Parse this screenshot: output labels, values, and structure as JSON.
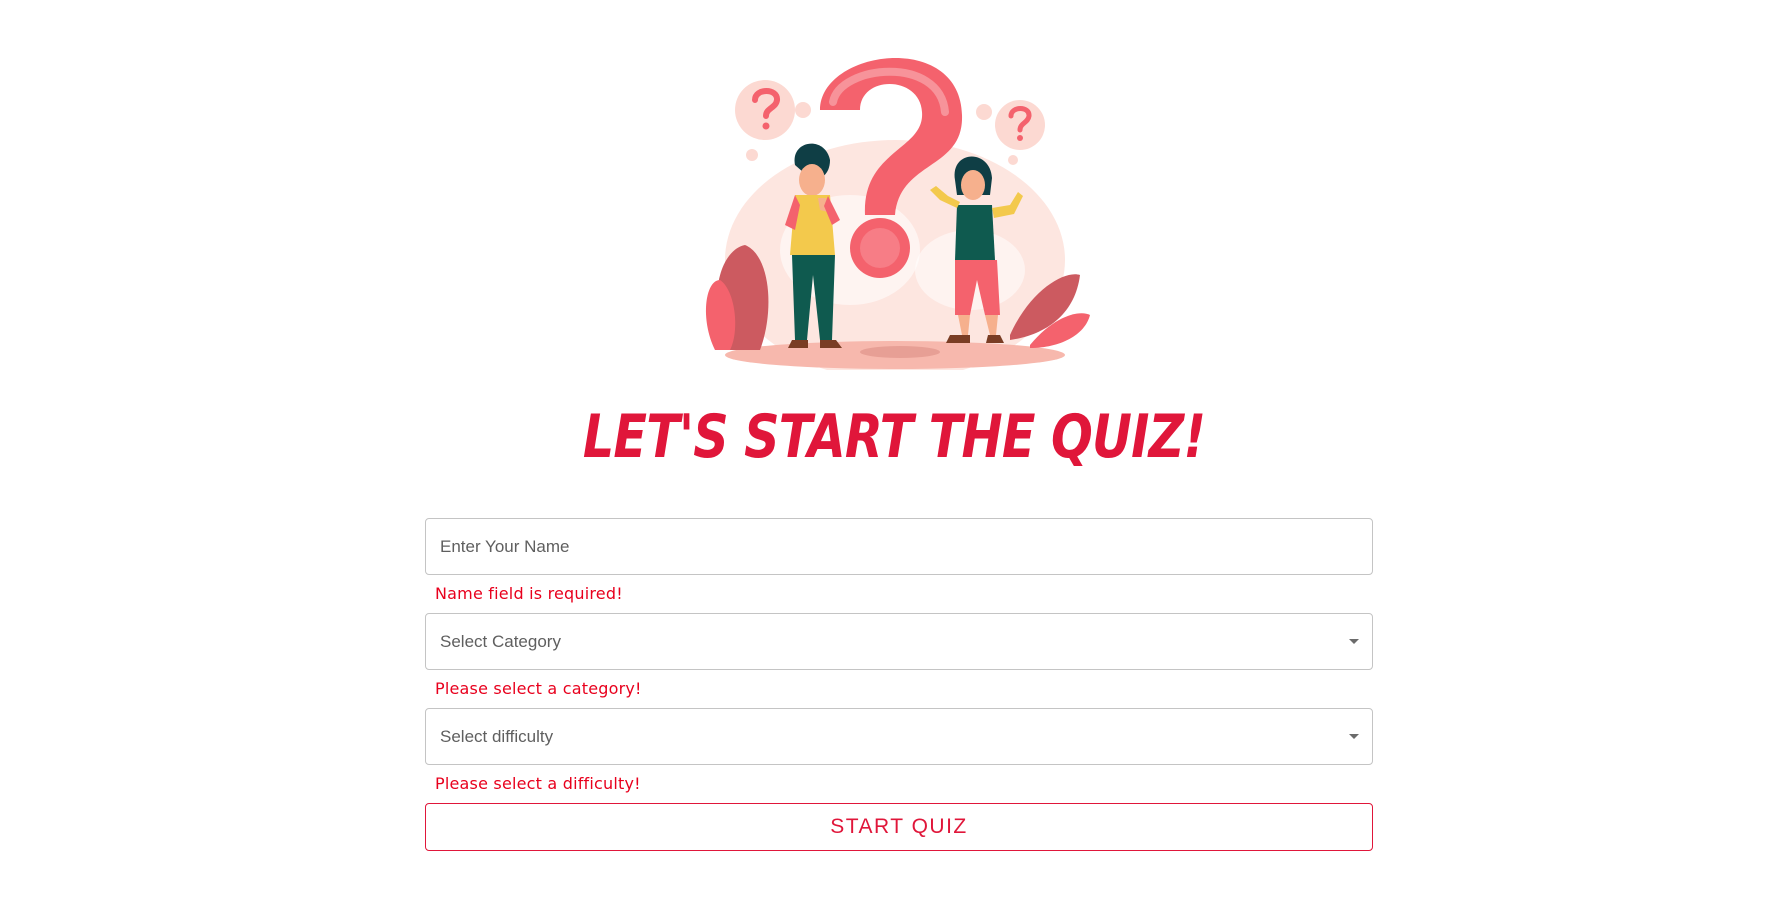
{
  "header": {
    "title": "LET'S START THE QUIZ!"
  },
  "illustration": {
    "name": "quiz-question-illustration",
    "colors": {
      "primary": "#f4626d",
      "light": "#fcd9d2",
      "dark": "#cc4a55",
      "green": "#0f5a4f",
      "skin": "#f6b08d"
    }
  },
  "form": {
    "name": {
      "placeholder": "Enter Your Name",
      "value": "",
      "error": "Name field is required!"
    },
    "category": {
      "selected_label": "Select Category",
      "error": "Please select a category!"
    },
    "difficulty": {
      "selected_label": "Select difficulty",
      "error": "Please select a difficulty!"
    },
    "submit_label": "START QUIZ"
  },
  "theme": {
    "accent": "#e0163a",
    "error": "#e8001d",
    "border": "#c4c4c4"
  }
}
